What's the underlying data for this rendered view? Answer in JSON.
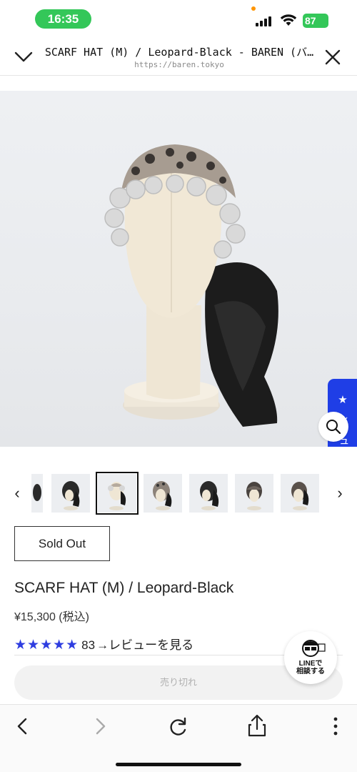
{
  "status": {
    "time": "16:35",
    "battery": "87"
  },
  "browser": {
    "title": "SCARF HAT (M) / Leopard-Black - BAREN (バ…",
    "url": "https://baren.tokyo"
  },
  "review_tab": {
    "label": "★ レビュー"
  },
  "product": {
    "sold_out_label": "Sold Out",
    "name": "SCARF HAT (M) / Leopard-Black",
    "price": "¥15,300 (税込)",
    "stars": "★★★★★",
    "rating_value": 5,
    "review_count": "83",
    "review_link": "→レビューを見る",
    "soldout_bar_label": "売り切れ"
  },
  "line_badge": {
    "line1": "LINEで",
    "line2": "相談する"
  },
  "thumbnails": {
    "count": 7,
    "selected_index": 1
  },
  "colors": {
    "accent_blue": "#1f3ee6",
    "star_blue": "#2e3de0",
    "status_green": "#34c759"
  }
}
